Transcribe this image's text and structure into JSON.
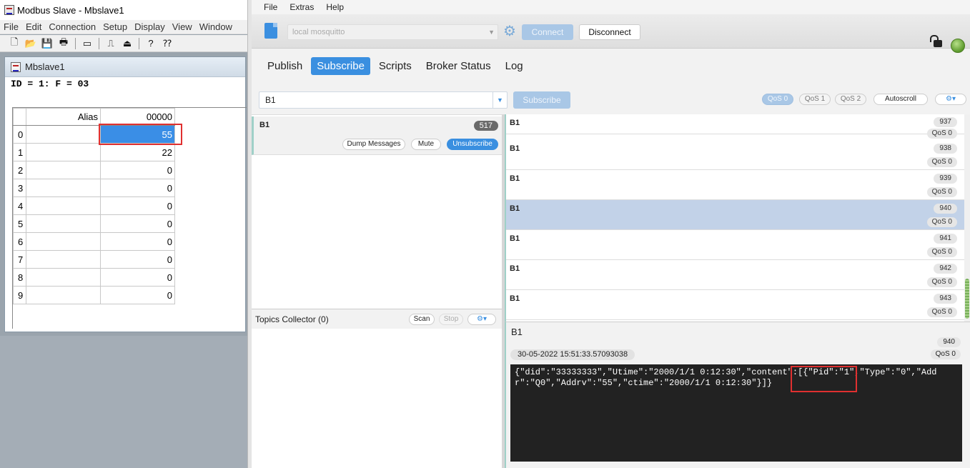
{
  "modbus": {
    "window_title": "Modbus Slave - Mbslave1",
    "menu": [
      "File",
      "Edit",
      "Connection",
      "Setup",
      "Display",
      "View",
      "Window"
    ],
    "toolbar_icons": [
      "new-icon",
      "open-icon",
      "save-icon",
      "print-icon",
      "window-icon",
      "connect-icon",
      "disconnect-icon",
      "help-icon",
      "whats-this-icon"
    ],
    "child_title": "Mbslave1",
    "id_line": "ID = 1: F = 03",
    "columns": {
      "alias": "Alias",
      "address": "00000"
    },
    "rows": [
      {
        "index": "0",
        "alias": "",
        "value": "55"
      },
      {
        "index": "1",
        "alias": "",
        "value": "22"
      },
      {
        "index": "2",
        "alias": "",
        "value": "0"
      },
      {
        "index": "3",
        "alias": "",
        "value": "0"
      },
      {
        "index": "4",
        "alias": "",
        "value": "0"
      },
      {
        "index": "5",
        "alias": "",
        "value": "0"
      },
      {
        "index": "6",
        "alias": "",
        "value": "0"
      },
      {
        "index": "7",
        "alias": "",
        "value": "0"
      },
      {
        "index": "8",
        "alias": "",
        "value": "0"
      },
      {
        "index": "9",
        "alias": "",
        "value": "0"
      }
    ]
  },
  "mqtt": {
    "menu": [
      "File",
      "Extras",
      "Help"
    ],
    "profile": "local mosquitto",
    "connect_label": "Connect",
    "disconnect_label": "Disconnect",
    "tabs": [
      "Publish",
      "Subscribe",
      "Scripts",
      "Broker Status",
      "Log"
    ],
    "active_tab": "Subscribe",
    "topic_input": "B1",
    "subscribe_label": "Subscribe",
    "qos_buttons": [
      "QoS 0",
      "QoS 1",
      "QoS 2"
    ],
    "autoscroll_label": "Autoscroll",
    "subscription": {
      "topic": "B1",
      "count": "517",
      "dump_label": "Dump Messages",
      "mute_label": "Mute",
      "unsubscribe_label": "Unsubscribe"
    },
    "topics_collector": {
      "label": "Topics Collector (0)",
      "scan_label": "Scan",
      "stop_label": "Stop"
    },
    "messages": [
      {
        "topic": "B1",
        "num": "937",
        "qos": "QoS 0"
      },
      {
        "topic": "B1",
        "num": "938",
        "qos": "QoS 0"
      },
      {
        "topic": "B1",
        "num": "939",
        "qos": "QoS 0"
      },
      {
        "topic": "B1",
        "num": "940",
        "qos": "QoS 0",
        "selected": true
      },
      {
        "topic": "B1",
        "num": "941",
        "qos": "QoS 0"
      },
      {
        "topic": "B1",
        "num": "942",
        "qos": "QoS 0"
      },
      {
        "topic": "B1",
        "num": "943",
        "qos": "QoS 0"
      }
    ],
    "detail": {
      "topic": "B1",
      "num": "940",
      "timestamp": "30-05-2022  15:51:33.57093038",
      "qos": "QoS 0",
      "payload": "{\"did\":\"33333333\",\"Utime\":\"2000/1/1 0:12:30\",\"content\":[{\"Pid\":\"1\",\"Type\":\"0\",\"Addr\":\"Q0\",\"Addrv\":\"55\",\"ctime\":\"2000/1/1 0:12:30\"}]}"
    }
  }
}
